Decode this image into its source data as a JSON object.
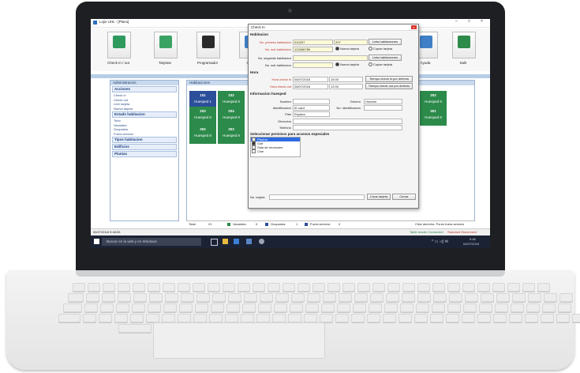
{
  "app": {
    "title": "Lojix UHL - [Plano]"
  },
  "toolbar": {
    "items": [
      "Check In / out",
      "Tarjetas",
      "Programador",
      "Infor",
      "Ayuda",
      "Salir"
    ]
  },
  "left_panel": {
    "title": "Administracion",
    "groups": [
      {
        "label": "Acciones",
        "items": [
          "Check in",
          "Check out",
          "Leer tarjeta",
          "Nueva tarjeta"
        ]
      },
      {
        "label": "Estado habitacion",
        "items": [
          "Todo",
          "Vacantes",
          "Ocupados",
          "Fuera servicio"
        ]
      },
      {
        "label": "Tipos habitacion",
        "items": []
      },
      {
        "label": "Edificios",
        "items": []
      },
      {
        "label": "Plantas",
        "items": []
      }
    ]
  },
  "rooms_panel": {
    "title": "Habitaciones",
    "rooms": [
      {
        "number": "101",
        "guest": "Huesped 1",
        "status": "blue"
      },
      {
        "number": "102",
        "guest": "Huesped 8",
        "status": "green"
      },
      {
        "number": "203",
        "guest": "Huesped 8",
        "status": "green"
      },
      {
        "number": "204",
        "guest": "Huesped 8",
        "status": "green"
      },
      {
        "number": "302",
        "guest": "Huesped 8",
        "status": "green"
      },
      {
        "number": "303",
        "guest": "Huesped 8",
        "status": "green"
      },
      {
        "number": "202",
        "guest": "Huesped 8",
        "status": "green"
      },
      {
        "number": "301",
        "guest": "Huesped 8",
        "status": "green"
      }
    ]
  },
  "dialog": {
    "title": "Check In",
    "close": "x",
    "sec_room": "Habitacion",
    "first_room_label": "No. primera habitacion",
    "first_room_value": "010207",
    "first_room_code": "207",
    "list_btn1": "Lista habitaciones",
    "sub_room_label": "No. sub habitacion",
    "sub_room_value": "123456789",
    "new_card": "Nueva tarjeta",
    "copy_card": "Copiar tarjeta",
    "second_room_label": "No. segunda habitacion",
    "list_btn2": "Lista habitaciones",
    "sub_room2_label": "No. sub habitacion",
    "new_card2": "Nueva tarjeta",
    "copy_card2": "Copiar tarjeta",
    "sec_time": "Hora",
    "checkin_label": "Hora check in",
    "checkin_date": "04/07/2018",
    "checkin_time": "15:00",
    "checkin_default_btn": "Tiempo check in por defecto",
    "checkout_label": "Hora check out",
    "checkout_date": "26/07/2018",
    "checkout_time": "12:00",
    "checkout_default_btn": "Tiempo check out por defecto",
    "sec_guest": "Informacion huesped",
    "name_label": "Nombre",
    "gender_label": "Genero",
    "gender_value": "Hombre",
    "id_label": "Identificacion",
    "id_value": "ID card",
    "id_no_label": "No. identificacion",
    "country_label": "Pais",
    "country_value": "Espana",
    "address_label": "Direccion",
    "phone_label": "Telefono",
    "sec_access": "Seleccionar permisos para accesos especiales",
    "access_items": [
      {
        "label": "Piscina",
        "checked": true,
        "selected": true
      },
      {
        "label": "Golf",
        "checked": true,
        "selected": false
      },
      {
        "label": "Sala de reuniones",
        "checked": false,
        "selected": false
      },
      {
        "label": "Cine",
        "checked": false,
        "selected": false
      }
    ],
    "card_no_label": "No. tarjeta",
    "create_btn": "Crear tarjeta",
    "cancel_btn": "Cerrar"
  },
  "status_bar": {
    "total_label": "Total:",
    "total_value": "21",
    "vacant_label": "Vacantes:",
    "vacant_value": "0",
    "occupied_label": "Ocupados:",
    "occupied_value": "1",
    "oos_label": "Fuera servicio:",
    "oos_value": "0",
    "right_hint": "Click derecho: Poner fuera servicio",
    "datetime": "04/07/2018 9:48:06",
    "reader_status": "Table reader Connected",
    "disconnect": "Standard Disconnect"
  },
  "taskbar": {
    "search_placeholder": "Buscar en la web y en Windows",
    "clock_time": "9:48",
    "clock_date": "04/07/2018"
  },
  "colors": {
    "accent_green": "#2c8a4a",
    "accent_blue": "#2c4f9a",
    "dialog_close": "#d9342b"
  }
}
